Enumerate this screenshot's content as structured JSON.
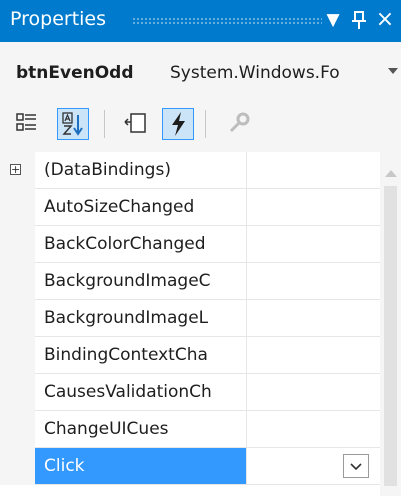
{
  "window": {
    "title": "Properties"
  },
  "object_selector": {
    "name": "btnEvenOdd",
    "type": "System.Windows.Fo"
  },
  "toolbar": {
    "icons": [
      "categorized-icon",
      "alphabetical-icon",
      "properties-icon",
      "events-icon",
      "property-pages-icon"
    ]
  },
  "grid": {
    "rows": [
      {
        "name": "(DataBindings)"
      },
      {
        "name": "AutoSizeChanged"
      },
      {
        "name": "BackColorChanged"
      },
      {
        "name": "BackgroundImageC"
      },
      {
        "name": "BackgroundImageL"
      },
      {
        "name": "BindingContextCha"
      },
      {
        "name": "CausesValidationCh"
      },
      {
        "name": "ChangeUICues"
      },
      {
        "name": "Click"
      }
    ],
    "selected": "Click",
    "expander_symbol": "+"
  },
  "colors": {
    "titlebar": "#007acc",
    "selection": "#3399ff",
    "tool_selected": "#cce4f7"
  }
}
